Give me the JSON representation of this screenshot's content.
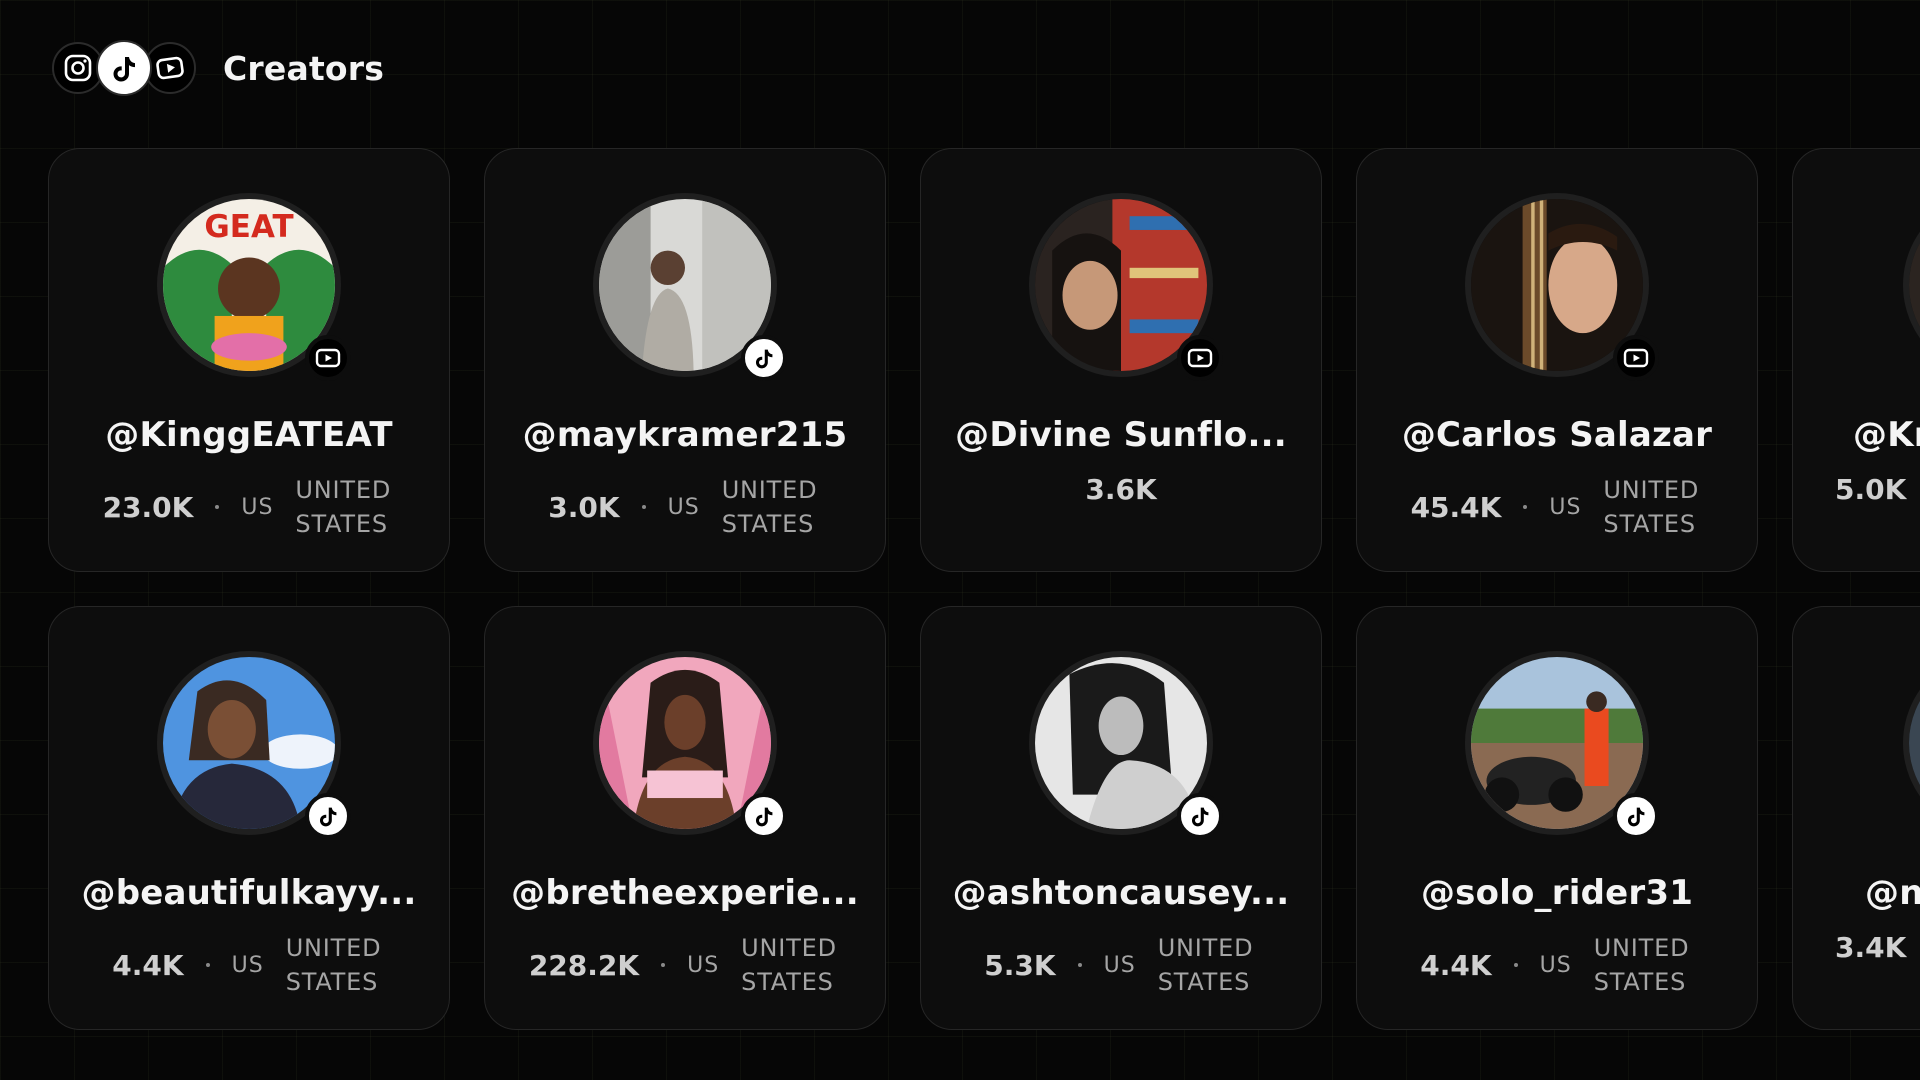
{
  "header": {
    "title": "Creators",
    "logos": [
      "instagram-icon",
      "tiktok-icon",
      "youtube-icon"
    ]
  },
  "creators": [
    {
      "handle": "@KinggEATEAT",
      "followers": "23.0K",
      "country_code": "US",
      "country": "UNITED STATES",
      "platform": "youtube"
    },
    {
      "handle": "@maykramer215",
      "followers": "3.0K",
      "country_code": "US",
      "country": "UNITED STATES",
      "platform": "tiktok"
    },
    {
      "handle": "@Divine Sunflo...",
      "followers": "3.6K",
      "country_code": "",
      "country": "",
      "platform": "youtube"
    },
    {
      "handle": "@Carlos Salazar",
      "followers": "45.4K",
      "country_code": "US",
      "country": "UNITED STATES",
      "platform": "youtube"
    },
    {
      "handle": "@Kr",
      "followers": "5.0K",
      "country_code": "",
      "country": "",
      "platform": ""
    },
    {
      "handle": "@beautifulkayy...",
      "followers": "4.4K",
      "country_code": "US",
      "country": "UNITED STATES",
      "platform": "tiktok"
    },
    {
      "handle": "@bretheexperie...",
      "followers": "228.2K",
      "country_code": "US",
      "country": "UNITED STATES",
      "platform": "tiktok"
    },
    {
      "handle": "@ashtoncausey...",
      "followers": "5.3K",
      "country_code": "US",
      "country": "UNITED STATES",
      "platform": "tiktok"
    },
    {
      "handle": "@solo_rider31",
      "followers": "4.4K",
      "country_code": "US",
      "country": "UNITED STATES",
      "platform": "tiktok"
    },
    {
      "handle": "@n",
      "followers": "3.4K",
      "country_code": "",
      "country": "",
      "platform": ""
    }
  ],
  "colors": {
    "background": "#060606",
    "card": "#0d0d0d",
    "card_border": "#262626",
    "text_primary": "#f4f4f4",
    "text_secondary": "#a5a5a5"
  }
}
